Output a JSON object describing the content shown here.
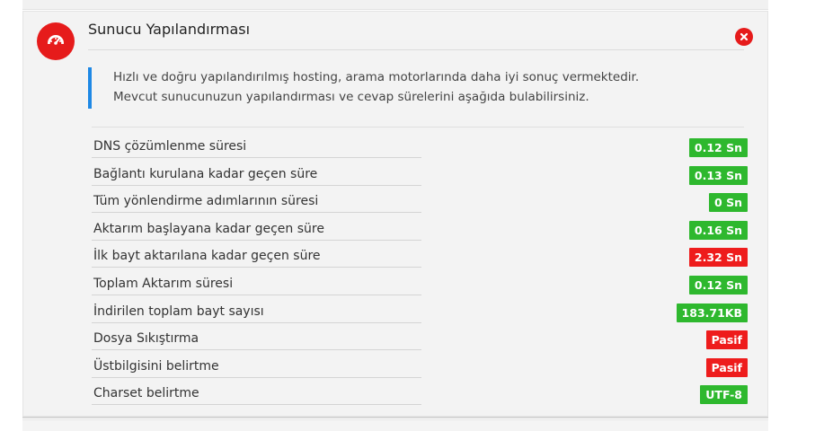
{
  "panel": {
    "title": "Sunucu Yapılandırması",
    "info_lines": [
      "Hızlı ve doğru yapılandırılmış hosting, arama motorlarında daha iyi sonuç vermektedir.",
      "Mevcut sunucunuzun yapılandırması ve cevap sürelerini aşağıda bulabilirsiniz."
    ],
    "icons": {
      "header": "speedometer-icon",
      "close": "close-icon"
    },
    "colors": {
      "accent_red": "#e61b1b",
      "info_border": "#1e88e5",
      "status_good": "#2eb82e",
      "status_bad": "#ee1c1c"
    }
  },
  "metrics": [
    {
      "label": "DNS çözümlenme süresi",
      "value": "0.12 Sn",
      "status": "good"
    },
    {
      "label": "Bağlantı kurulana kadar geçen süre",
      "value": "0.13 Sn",
      "status": "good"
    },
    {
      "label": "Tüm yönlendirme adımlarının süresi",
      "value": "0 Sn",
      "status": "good"
    },
    {
      "label": "Aktarım başlayana kadar geçen süre",
      "value": "0.16 Sn",
      "status": "good"
    },
    {
      "label": "İlk bayt aktarılana kadar geçen süre",
      "value": "2.32 Sn",
      "status": "bad"
    },
    {
      "label": "Toplam Aktarım süresi",
      "value": "0.12 Sn",
      "status": "good"
    },
    {
      "label": "İndirilen toplam bayt sayısı",
      "value": "183.71KB",
      "status": "good"
    },
    {
      "label": "Dosya Sıkıştırma",
      "value": "Pasif",
      "status": "bad"
    },
    {
      "label": "Üstbilgisini belirtme",
      "value": "Pasif",
      "status": "bad"
    },
    {
      "label": "Charset belirtme",
      "value": "UTF-8",
      "status": "good"
    }
  ]
}
